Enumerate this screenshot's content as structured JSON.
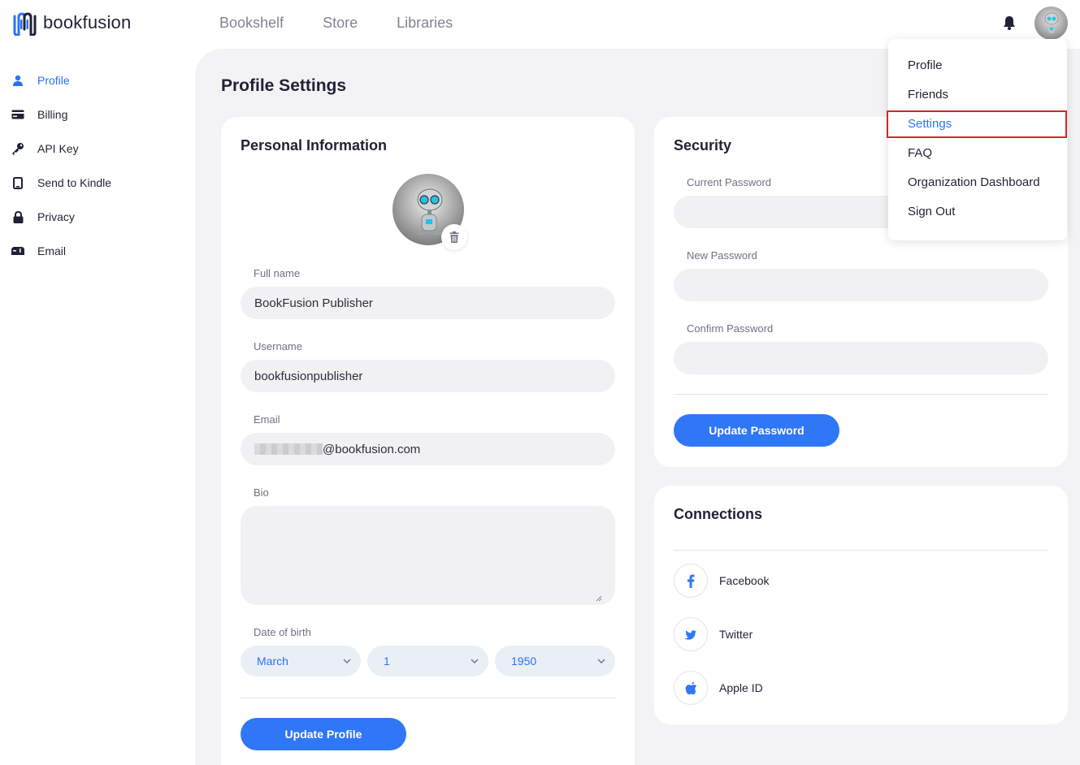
{
  "header": {
    "logo_text": "bookfusion",
    "nav": [
      "Bookshelf",
      "Store",
      "Libraries"
    ]
  },
  "sidebar": {
    "items": [
      {
        "label": "Profile",
        "icon": "user-icon",
        "active": true
      },
      {
        "label": "Billing",
        "icon": "credit-card-icon",
        "active": false
      },
      {
        "label": "API Key",
        "icon": "key-icon",
        "active": false
      },
      {
        "label": "Send to Kindle",
        "icon": "tablet-icon",
        "active": false
      },
      {
        "label": "Privacy",
        "icon": "lock-icon",
        "active": false
      },
      {
        "label": "Email",
        "icon": "mailbox-icon",
        "active": false
      }
    ]
  },
  "page": {
    "title": "Profile Settings"
  },
  "personal": {
    "title": "Personal Information",
    "full_name_label": "Full name",
    "full_name_value": "BookFusion Publisher",
    "username_label": "Username",
    "username_value": "bookfusionpublisher",
    "email_label": "Email",
    "email_value": "@bookfusion.com",
    "bio_label": "Bio",
    "bio_value": "",
    "dob_label": "Date of birth",
    "dob_month": "March",
    "dob_day": "1",
    "dob_year": "1950",
    "update_button": "Update Profile"
  },
  "security": {
    "title": "Security",
    "current_password_label": "Current Password",
    "new_password_label": "New Password",
    "confirm_password_label": "Confirm Password",
    "update_button": "Update Password"
  },
  "connections": {
    "title": "Connections",
    "items": [
      {
        "label": "Facebook",
        "icon": "facebook-icon"
      },
      {
        "label": "Twitter",
        "icon": "twitter-icon"
      },
      {
        "label": "Apple ID",
        "icon": "apple-icon"
      }
    ]
  },
  "user_menu": {
    "items": [
      "Profile",
      "Friends",
      "Settings",
      "FAQ",
      "Organization Dashboard",
      "Sign Out"
    ],
    "highlighted": "Settings"
  },
  "colors": {
    "accent": "#2f77f6",
    "highlight_border": "#d7262e",
    "main_background": "#f3f3f5"
  }
}
